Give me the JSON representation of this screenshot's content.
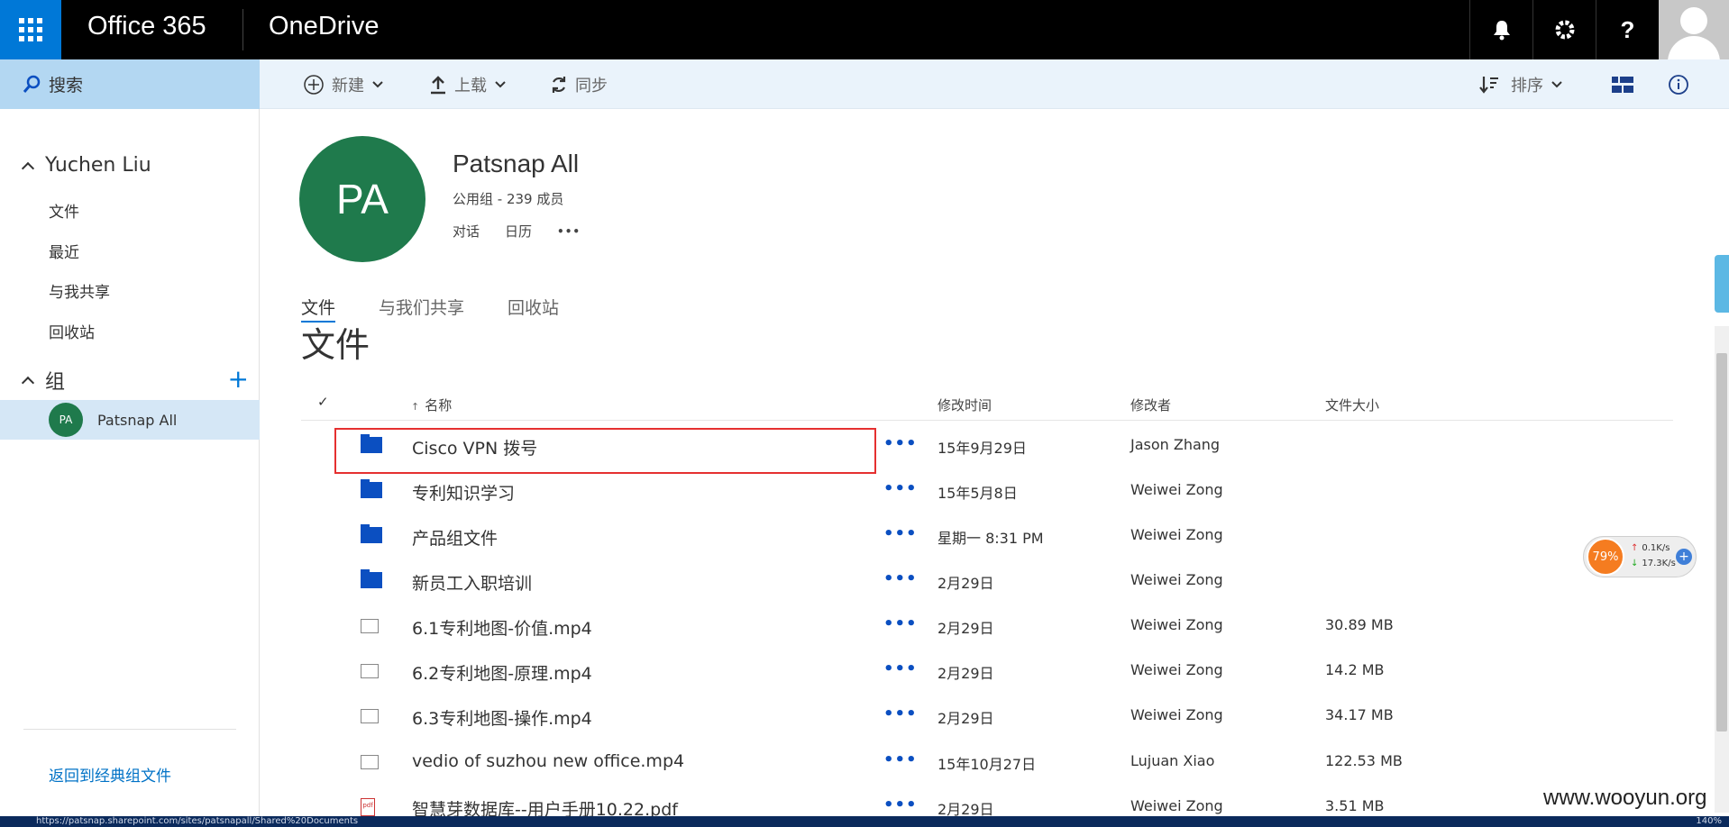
{
  "suitebar": {
    "brand": "Office 365",
    "app": "OneDrive",
    "help": "?"
  },
  "search": {
    "label": "搜索"
  },
  "commands": {
    "new": "新建",
    "upload": "上载",
    "sync": "同步",
    "sort": "排序"
  },
  "nav": {
    "user": "Yuchen Liu",
    "items": [
      "文件",
      "最近",
      "与我共享",
      "回收站"
    ],
    "groups_label": "组",
    "group_item": {
      "initials": "PA",
      "name": "Patsnap All"
    },
    "back_link": "返回到经典组文件"
  },
  "group": {
    "initials": "PA",
    "title": "Patsnap All",
    "subtitle": "公用组 - 239 成员",
    "links": [
      "对话",
      "日历",
      "•••"
    ]
  },
  "tabs": [
    "文件",
    "与我们共享",
    "回收站"
  ],
  "section_title": "文件",
  "list": {
    "headers": {
      "check": "✓",
      "name": "名称",
      "sort_arrow": "↑",
      "modified": "修改时间",
      "modified_by": "修改者",
      "size": "文件大小"
    },
    "more": "•••",
    "rows": [
      {
        "type": "folder",
        "name": "Cisco VPN 拨号",
        "modified": "15年9月29日",
        "by": "Jason Zhang",
        "size": ""
      },
      {
        "type": "folder",
        "name": "专利知识学习",
        "modified": "15年5月8日",
        "by": "Weiwei Zong",
        "size": ""
      },
      {
        "type": "folder",
        "name": "产品组文件",
        "modified": "星期一 8:31 PM",
        "by": "Weiwei Zong",
        "size": ""
      },
      {
        "type": "folder",
        "name": "新员工入职培训",
        "modified": "2月29日",
        "by": "Weiwei Zong",
        "size": ""
      },
      {
        "type": "file",
        "name": "6.1专利地图-价值.mp4",
        "modified": "2月29日",
        "by": "Weiwei Zong",
        "size": "30.89 MB"
      },
      {
        "type": "file",
        "name": "6.2专利地图-原理.mp4",
        "modified": "2月29日",
        "by": "Weiwei Zong",
        "size": "14.2 MB"
      },
      {
        "type": "file",
        "name": "6.3专利地图-操作.mp4",
        "modified": "2月29日",
        "by": "Weiwei Zong",
        "size": "34.17 MB"
      },
      {
        "type": "file",
        "name": "vedio of suzhou new office.mp4",
        "modified": "15年10月27日",
        "by": "Lujuan Xiao",
        "size": "122.53 MB"
      },
      {
        "type": "pdf",
        "name": "智慧芽数据库--用户手册10.22.pdf",
        "modified": "2月29日",
        "by": "Weiwei Zong",
        "size": "3.51 MB"
      }
    ]
  },
  "netwidget": {
    "percent": "79%",
    "up": "0.1K/s",
    "down": "17.3K/s"
  },
  "watermark": "www.wooyun.org",
  "statusbar": {
    "url": "https://patsnap.sharepoint.com/sites/patsnapall/Shared%20Documents",
    "right": "140%"
  },
  "colors": {
    "accent": "#0078d7",
    "group_avatar": "#1f7a4c",
    "highlight": "#e53030",
    "folder": "#0b4fc1"
  }
}
